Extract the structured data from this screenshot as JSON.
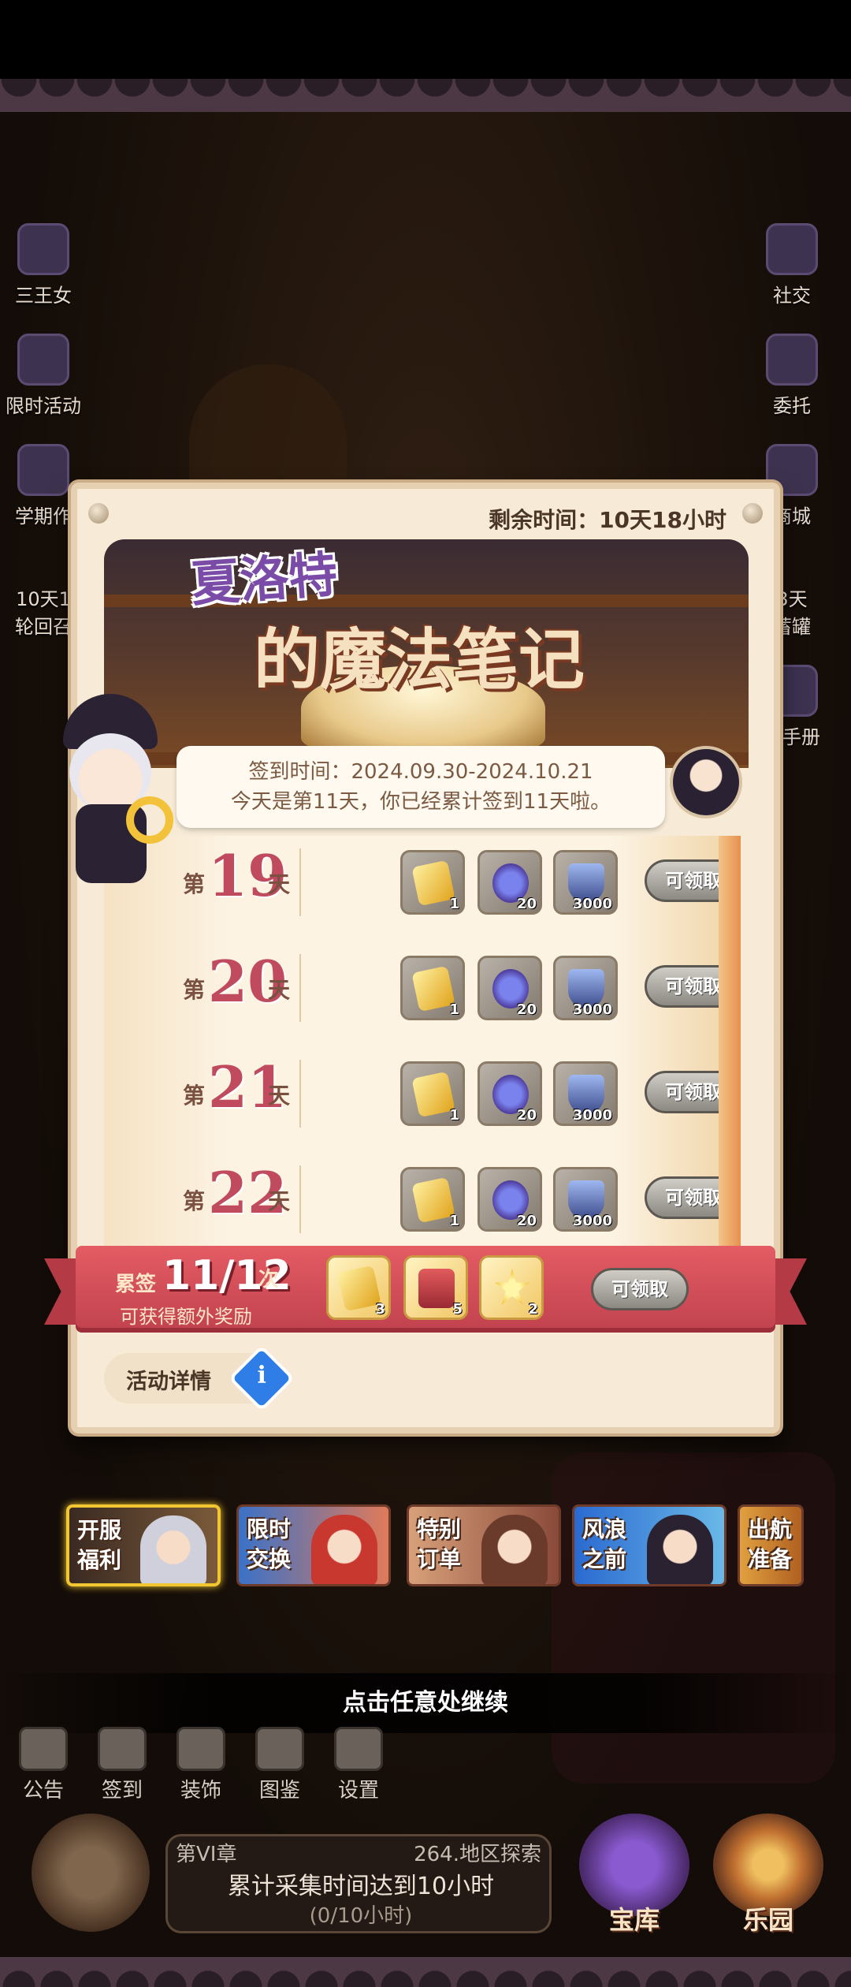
{
  "side_left": [
    "三王女",
    "限时活动",
    "学期作",
    "10天1",
    "轮回召"
  ],
  "side_right": [
    "社交",
    "委托",
    "商城",
    "3天",
    "蓄罐",
    "长手册"
  ],
  "panel": {
    "timer": "剩余时间：10天18小时",
    "title_line1": "夏洛特",
    "title_line2": "的魔法笔记",
    "signin_period": "签到时间：2024.09.30-2024.10.21",
    "signin_status": "今天是第11天，你已经累计签到11天啦。",
    "rows": [
      {
        "prefix": "第",
        "day": "19",
        "suffix": "天",
        "rewards": [
          "1",
          "20",
          "3000"
        ],
        "claim": "可领取"
      },
      {
        "prefix": "第",
        "day": "20",
        "suffix": "天",
        "rewards": [
          "1",
          "20",
          "3000"
        ],
        "claim": "可领取"
      },
      {
        "prefix": "第",
        "day": "21",
        "suffix": "天",
        "rewards": [
          "1",
          "20",
          "3000"
        ],
        "claim": "可领取"
      },
      {
        "prefix": "第",
        "day": "22",
        "suffix": "天",
        "rewards": [
          "1",
          "20",
          "3000"
        ],
        "claim": "可领取"
      }
    ],
    "cumulative": {
      "label": "累签",
      "count": "11/12",
      "unit": "次",
      "subtitle": "可获得额外奖励",
      "rewards": [
        "3",
        "5",
        "2"
      ],
      "claim": "可领取"
    },
    "details_label": "活动详情",
    "details_icon": "i"
  },
  "promos": [
    {
      "line1": "开服",
      "line2": "福利"
    },
    {
      "line1": "限时",
      "line2": "交换"
    },
    {
      "line1": "特别",
      "line2": "订单"
    },
    {
      "line1": "风浪",
      "line2": "之前"
    },
    {
      "line1": "出航",
      "line2": "准备"
    }
  ],
  "continue_hint": "点击任意处继续",
  "bottom_menu": [
    "公告",
    "签到",
    "装饰",
    "图鉴",
    "设置"
  ],
  "quest": {
    "chapter": "第VI章",
    "area": "264.地区探索",
    "task": "累计采集时间达到10小时",
    "progress": "(0/10小时)"
  },
  "big_buttons": [
    "宝库",
    "乐园"
  ],
  "colors": {
    "panel_bg": "#f7ead7",
    "ribbon": "#c0424e",
    "day_number": "#c04a5e",
    "active_promo_border": "#f2c630"
  }
}
